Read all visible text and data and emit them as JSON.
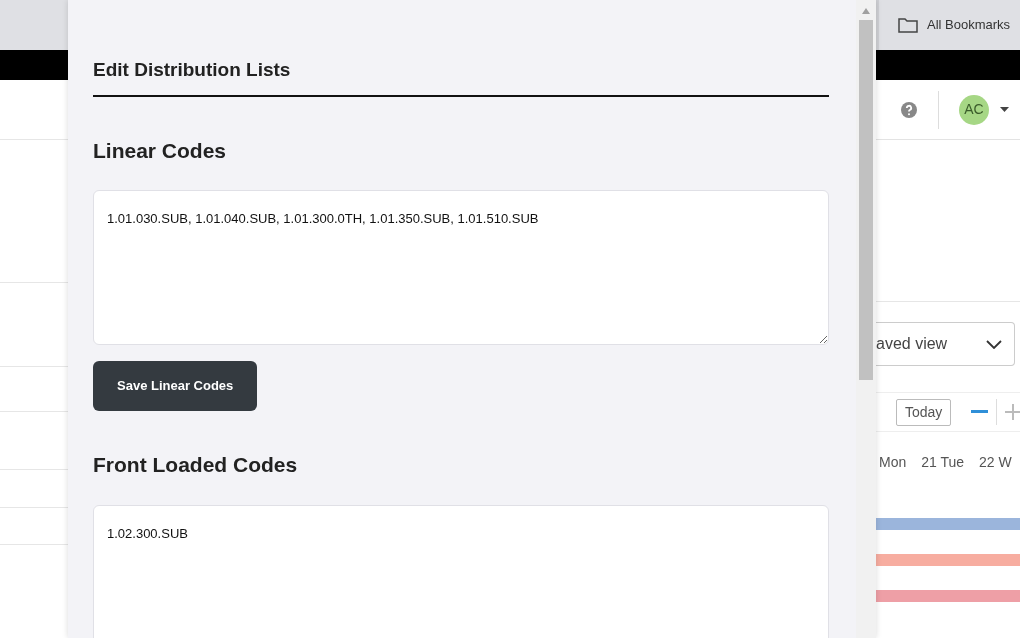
{
  "browser_bar": {
    "bookmarks_label": "All Bookmarks"
  },
  "app_header": {
    "avatar_initials": "AC"
  },
  "background_view": {
    "view_select": "aved view",
    "today_button": "Today",
    "days": [
      "Mon",
      "21 Tue",
      "22 W"
    ],
    "gantt_bars": [
      {
        "color": "#9bb5dc"
      },
      {
        "color": "#f7ada0"
      },
      {
        "color": "#ee9fa6"
      }
    ]
  },
  "dialog": {
    "title": "Edit Distribution Lists",
    "sections": [
      {
        "heading": "Linear Codes",
        "value": "1.01.030.SUB, 1.01.040.SUB, 1.01.300.0TH, 1.01.350.SUB, 1.01.510.SUB",
        "button": "Save Linear Codes"
      },
      {
        "heading": "Front Loaded Codes",
        "value": "1.02.300.SUB"
      }
    ]
  }
}
